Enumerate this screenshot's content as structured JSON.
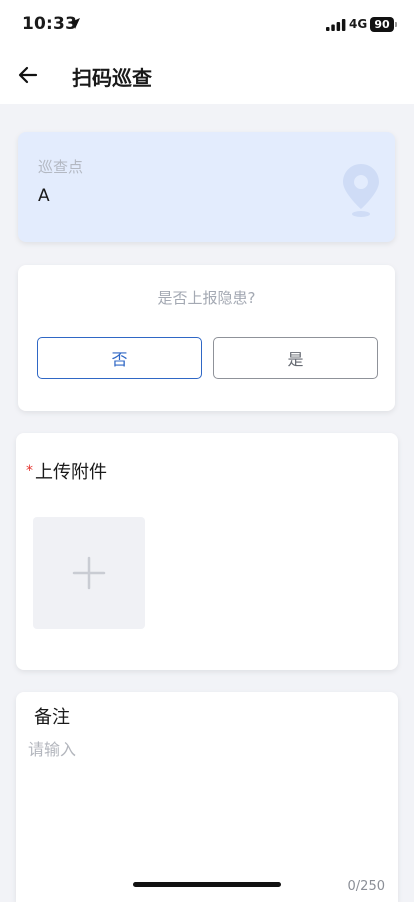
{
  "status_bar": {
    "time": "10:33",
    "network": "4G",
    "battery": "90",
    "icons": [
      "location-arrow-icon",
      "signal-icon",
      "battery-icon"
    ]
  },
  "nav": {
    "title": "扫码巡查",
    "back_icon": "arrow-left-icon"
  },
  "patrol_point": {
    "label": "巡查点",
    "value": "A",
    "icon": "map-pin-icon"
  },
  "hazard_question": {
    "text": "是否上报隐患?",
    "options": [
      {
        "label": "否",
        "selected": true
      },
      {
        "label": "是",
        "selected": false
      }
    ]
  },
  "attachment": {
    "required_mark": "*",
    "title": "上传附件",
    "add_icon": "plus-icon"
  },
  "remark": {
    "title": "备注",
    "placeholder": "请输入",
    "value": "",
    "counter": "0/250"
  },
  "colors": {
    "accent": "#2f67c5",
    "point_card_bg": "#e3ecfd",
    "required": "#e5322d",
    "page_bg": "#f2f3f7"
  }
}
